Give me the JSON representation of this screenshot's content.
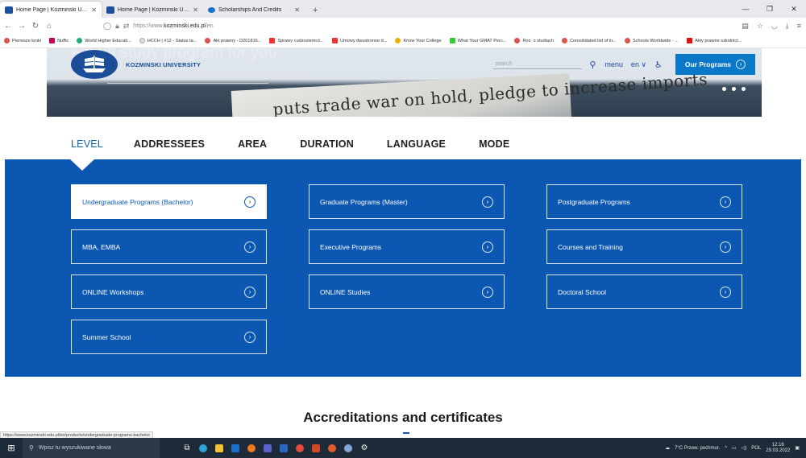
{
  "browser": {
    "tabs": [
      {
        "title": "Home Page | Kozminski Univer",
        "active": true
      },
      {
        "title": "Home Page | Kozminski Univer",
        "active": false
      },
      {
        "title": "Scholarships And Credits",
        "active": false
      }
    ],
    "new_tab": "+",
    "url_prefix": "https://www.",
    "url_domain": "kozminski.edu.pl",
    "url_path": "/en",
    "bookmarks": [
      "Pierwsze kroki",
      "Nuffic",
      "World Higher Educati...",
      "HCCH | #12 - Status ta...",
      "Akt prawny - D201816...",
      "Sprawy cudzoziemcó...",
      "Umowy dwustronne d...",
      "Know Your College",
      "What Your GMAT Perc...",
      "Roz. o studiach",
      "Consolidated list of in...",
      "Schools Worldwide - ...",
      "Akty prawne szkolnict..."
    ]
  },
  "site": {
    "logo_text": "KOZMINSKI UNIVERSITY",
    "search_placeholder": "search",
    "menu_label": "menu",
    "lang_label": "en ∨",
    "our_programs_label": "Our Programs",
    "hero_overlay": "Find a study program for you",
    "hero_headline": "puts trade war on hold, pledge to increase imports"
  },
  "filters": {
    "tabs": [
      "LEVEL",
      "ADDRESSEES",
      "AREA",
      "DURATION",
      "LANGUAGE",
      "MODE"
    ],
    "active_index": 0
  },
  "programs": [
    {
      "label": "Undergraduate Programs (Bachelor)",
      "selected": true
    },
    {
      "label": "Graduate Programs (Master)",
      "selected": false
    },
    {
      "label": "Postgraduate Programs",
      "selected": false
    },
    {
      "label": "MBA, EMBA",
      "selected": false
    },
    {
      "label": "Executive Programs",
      "selected": false
    },
    {
      "label": "Courses and Training",
      "selected": false
    },
    {
      "label": "ONLINE Workshops",
      "selected": false
    },
    {
      "label": "ONLINE Studies",
      "selected": false
    },
    {
      "label": "Doctoral School",
      "selected": false
    },
    {
      "label": "Summer School",
      "selected": false
    }
  ],
  "accreditations_title": "Accreditations and certificates",
  "status_url": "https://www.kozminski.edu.pl/en/products/undergraduate-programs-bachelor",
  "taskbar": {
    "search_placeholder": "Wpisz tu wyszukiwane słowa",
    "weather": "7°C Przew. pochmur.",
    "lang": "POL",
    "time": "12:16",
    "date": "29.03.2022"
  },
  "colors": {
    "brand_blue": "#0b57b2",
    "cta_blue": "#0a78c8",
    "logo_blue": "#1b4d99"
  }
}
